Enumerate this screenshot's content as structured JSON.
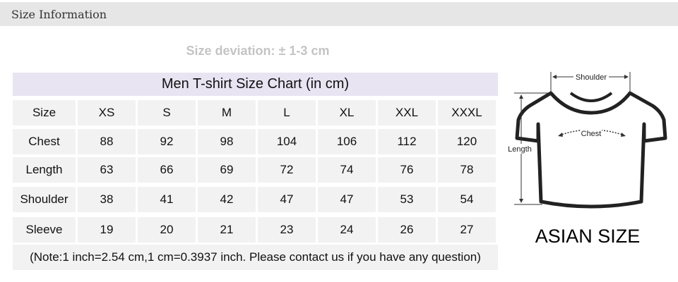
{
  "header": {
    "title": "Size Information"
  },
  "deviation": "Size deviation:  ± 1-3 cm",
  "table": {
    "title": "Men T-shirt Size Chart (in cm)",
    "rows": [
      {
        "label": "Size",
        "values": [
          "XS",
          "S",
          "M",
          "L",
          "XL",
          "XXL",
          "XXXL"
        ]
      },
      {
        "label": "Chest",
        "values": [
          "88",
          "92",
          "98",
          "104",
          "106",
          "112",
          "120"
        ]
      },
      {
        "label": "Length",
        "values": [
          "63",
          "66",
          "69",
          "72",
          "74",
          "76",
          "78"
        ]
      },
      {
        "label": "Shoulder",
        "values": [
          "38",
          "41",
          "42",
          "47",
          "47",
          "53",
          "54"
        ]
      },
      {
        "label": "Sleeve",
        "values": [
          "19",
          "20",
          "21",
          "23",
          "24",
          "26",
          "27"
        ]
      }
    ],
    "note": "(Note:1 inch=2.54 cm,1 cm=0.3937 inch. Please contact us if you have any question)"
  },
  "diagram": {
    "shoulder_label": "Shoulder",
    "chest_label": "Chest",
    "length_label": "Length",
    "caption": "ASIAN SIZE"
  }
}
